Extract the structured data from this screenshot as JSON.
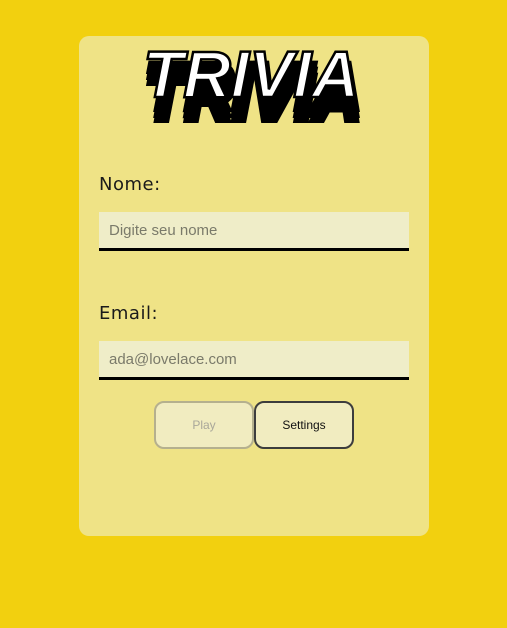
{
  "logo": {
    "text": "TRIVIA"
  },
  "form": {
    "name_label": "Nome:",
    "name_placeholder": "Digite seu nome",
    "email_label": "Email:",
    "email_placeholder": "ada@lovelace.com"
  },
  "buttons": {
    "play_label": "Play",
    "play_disabled": true,
    "settings_label": "Settings"
  },
  "colors": {
    "background": "#f2d00f",
    "card": "#efe386",
    "input_background": "#efedc8",
    "input_border": "#000000"
  }
}
